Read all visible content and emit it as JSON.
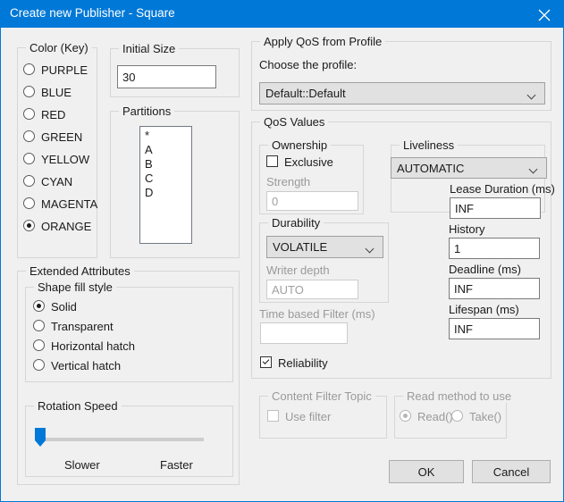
{
  "window": {
    "title": "Create new Publisher - Square",
    "close_icon": "close-icon",
    "accent_color": "#0078d7",
    "background_color": "#f0f0f0"
  },
  "color_key": {
    "legend": "Color (Key)",
    "options": [
      {
        "label": "PURPLE",
        "selected": false
      },
      {
        "label": "BLUE",
        "selected": false
      },
      {
        "label": "RED",
        "selected": false
      },
      {
        "label": "GREEN",
        "selected": false
      },
      {
        "label": "YELLOW",
        "selected": false
      },
      {
        "label": "CYAN",
        "selected": false
      },
      {
        "label": "MAGENTA",
        "selected": false
      },
      {
        "label": "ORANGE",
        "selected": true
      }
    ]
  },
  "initial_size": {
    "legend": "Initial Size",
    "value": "30"
  },
  "partitions": {
    "legend": "Partitions",
    "items": [
      "*",
      "A",
      "B",
      "C",
      "D"
    ]
  },
  "extended_attributes": {
    "legend": "Extended Attributes",
    "shape_fill_style": {
      "legend": "Shape fill style",
      "options": [
        {
          "label": "Solid",
          "selected": true
        },
        {
          "label": "Transparent",
          "selected": false
        },
        {
          "label": "Horizontal hatch",
          "selected": false
        },
        {
          "label": "Vertical hatch",
          "selected": false
        }
      ]
    },
    "rotation_speed": {
      "legend": "Rotation Speed",
      "min_label": "Slower",
      "max_label": "Faster",
      "value": 0
    }
  },
  "apply_qos_from_profile": {
    "legend": "Apply QoS from Profile",
    "choose_label": "Choose the profile:",
    "profile_value": "Default::Default"
  },
  "qos_values": {
    "legend": "QoS Values",
    "ownership": {
      "legend": "Ownership",
      "exclusive_label": "Exclusive",
      "exclusive_checked": false,
      "strength_label": "Strength",
      "strength_value": "0",
      "strength_enabled": false
    },
    "durability": {
      "legend": "Durability",
      "kind_value": "VOLATILE",
      "writer_depth_label": "Writer depth",
      "writer_depth_value": "AUTO",
      "writer_depth_enabled": false
    },
    "time_based_filter": {
      "label": "Time based Filter (ms)",
      "value": "",
      "enabled": false
    },
    "liveliness": {
      "legend": "Liveliness",
      "kind_value": "AUTOMATIC",
      "lease_duration_label": "Lease Duration (ms)",
      "lease_duration_value": "INF"
    },
    "history": {
      "label": "History",
      "value": "1"
    },
    "deadline": {
      "label": "Deadline (ms)",
      "value": "INF"
    },
    "lifespan": {
      "label": "Lifespan (ms)",
      "value": "INF"
    },
    "reliability": {
      "label": "Reliability",
      "checked": true
    }
  },
  "content_filter_topic": {
    "legend": "Content Filter Topic",
    "use_filter_label": "Use filter",
    "use_filter_checked": false,
    "enabled": false
  },
  "read_method": {
    "legend": "Read method to use",
    "options": [
      {
        "label": "Read()",
        "selected": true
      },
      {
        "label": "Take()",
        "selected": false
      }
    ],
    "enabled": false
  },
  "footer": {
    "ok_label": "OK",
    "cancel_label": "Cancel"
  }
}
